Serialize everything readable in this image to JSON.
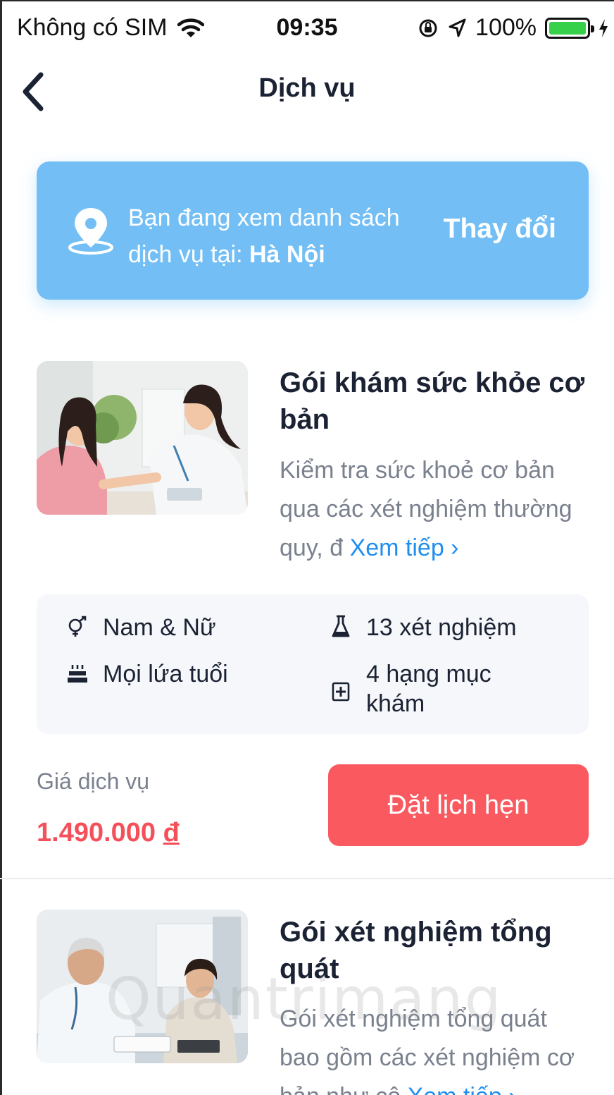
{
  "status_bar": {
    "carrier": "Không có SIM",
    "time": "09:35",
    "battery": "100%",
    "battery_color": "#37d04a"
  },
  "nav": {
    "title": "Dịch vụ",
    "back_icon": "chevron-left-icon"
  },
  "location_banner": {
    "line1": "Bạn đang xem danh sách",
    "line2_prefix": "dịch vụ tại: ",
    "city": "Hà Nội",
    "change_label": "Thay đổi",
    "background": "#73bff5"
  },
  "services": [
    {
      "title": "Gói khám sức khỏe cơ bản",
      "description": "Kiểm tra sức khoẻ cơ bản qua các xét nghiệm thường quy, đ",
      "more_label": "Xem tiếp ›",
      "gender": "Nam & Nữ",
      "tests": "13 xét nghiệm",
      "age": "Mọi lứa tuổi",
      "categories": "4 hạng mục khám",
      "price_label": "Giá dịch vụ",
      "price": "1.490.000",
      "currency": "đ",
      "book_label": "Đặt lịch hẹn"
    },
    {
      "title": "Gói xét nghiệm tổng quát",
      "description": "Gói xét nghiệm tổng quát bao gồm các xét nghiệm cơ bản như cô",
      "more_label": "Xem tiếp ›"
    }
  ],
  "watermark": "Quantrimang",
  "colors": {
    "accent_blue": "#1f8ef1",
    "price_red": "#f4505a",
    "button_red": "#fa5a5f"
  }
}
